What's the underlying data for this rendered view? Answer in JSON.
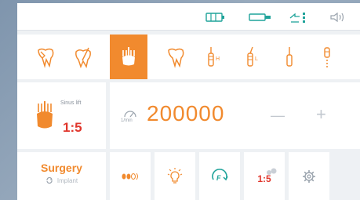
{
  "status": {
    "icons": [
      "battery-pack-icon",
      "handpiece-connector-icon",
      "irrigation-level-icon",
      "speaker-icon"
    ]
  },
  "tools": [
    {
      "name": "tooth-fracture-tool",
      "active": false
    },
    {
      "name": "endodontic-tool",
      "active": false
    },
    {
      "name": "sinus-lift-tool",
      "active": true
    },
    {
      "name": "tooth-extraction-tool",
      "active": false
    },
    {
      "name": "implant-h-tool",
      "active": false
    },
    {
      "name": "implant-l-tool",
      "active": false
    },
    {
      "name": "instrument-straight-tool",
      "active": false
    },
    {
      "name": "instrument-dotted-tool",
      "active": false
    }
  ],
  "mode": {
    "label": "Sinus lift",
    "ratio": "1:5"
  },
  "speed": {
    "unit_label": "1/min",
    "value": "200000",
    "minus_label": "—",
    "plus_label": "+"
  },
  "bottom": {
    "procedure": "Surgery",
    "sub_procedure": "Implant",
    "ratio": "1:5"
  },
  "colors": {
    "accent": "#f18a2e",
    "ratio_red": "#e0362c",
    "teal": "#1fa39a"
  }
}
